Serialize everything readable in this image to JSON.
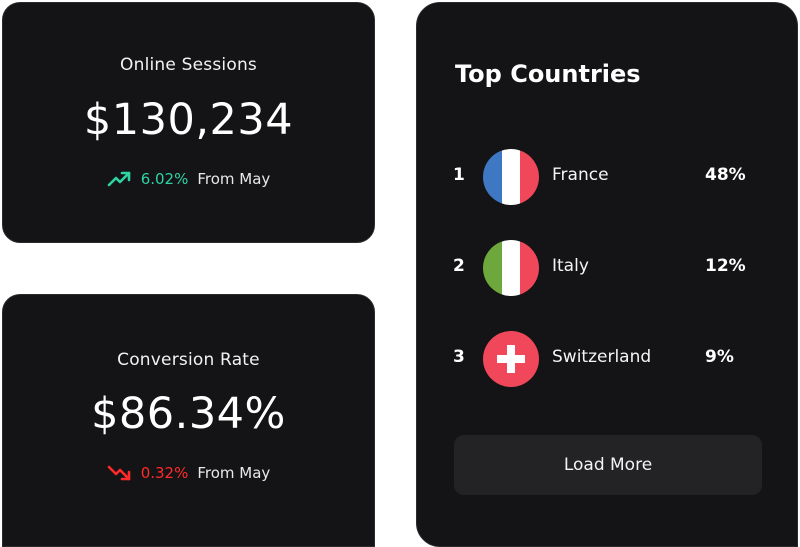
{
  "cards": {
    "online_sessions": {
      "label": "Online Sessions",
      "value": "$130,234",
      "trend": {
        "direction": "up",
        "percent": "6.02%",
        "suffix": "From May",
        "color": "#2fd3a0",
        "icon": "trending-up-icon"
      }
    },
    "conversion_rate": {
      "label": "Conversion Rate",
      "value": "$86.34%",
      "trend": {
        "direction": "down",
        "percent": "0.32%",
        "suffix": "From May",
        "color": "#ff2a2a",
        "icon": "trending-down-icon"
      }
    }
  },
  "top_countries": {
    "title": "Top Countries",
    "rows": [
      {
        "rank": "1",
        "name": "France",
        "percent": "48%",
        "flag": "france-flag-icon"
      },
      {
        "rank": "2",
        "name": "Italy",
        "percent": "12%",
        "flag": "italy-flag-icon"
      },
      {
        "rank": "3",
        "name": "Switzerland",
        "percent": "9%",
        "flag": "switzerland-flag-icon"
      }
    ],
    "load_more_label": "Load More"
  },
  "colors": {
    "card_background": "#141416",
    "button_background": "#232326",
    "trend_up": "#2fd3a0",
    "trend_down": "#ff2a2a"
  }
}
